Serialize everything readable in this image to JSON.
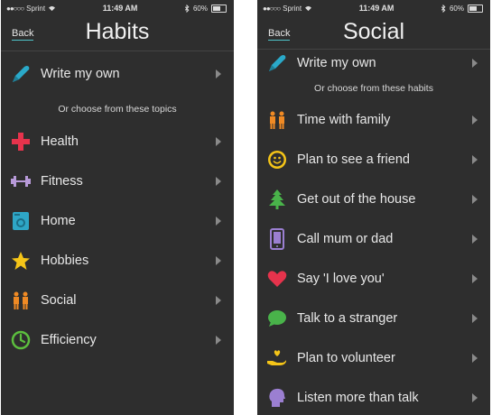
{
  "status_left": {
    "carrier": "Sprint",
    "time": "11:49 AM",
    "battery": "60%"
  },
  "status_right": {
    "carrier": "Sprint",
    "time": "11:49 AM",
    "battery": "60%"
  },
  "habits": {
    "back": "Back",
    "title": "Habits",
    "write_own": "Write my own",
    "subhead": "Or choose from these topics",
    "items": [
      {
        "label": "Health",
        "icon": "health-cross-icon"
      },
      {
        "label": "Fitness",
        "icon": "dumbbell-icon"
      },
      {
        "label": "Home",
        "icon": "washing-machine-icon"
      },
      {
        "label": "Hobbies",
        "icon": "star-icon"
      },
      {
        "label": "Social",
        "icon": "people-icon"
      },
      {
        "label": "Efficiency",
        "icon": "clock-icon"
      }
    ]
  },
  "social": {
    "back": "Back",
    "title": "Social",
    "write_own": "Write my own",
    "subhead": "Or choose from these habits",
    "items": [
      {
        "label": "Time with family",
        "icon": "family-icon"
      },
      {
        "label": "Plan to see a friend",
        "icon": "smiley-icon"
      },
      {
        "label": "Get out of the house",
        "icon": "tree-icon"
      },
      {
        "label": "Call mum or dad",
        "icon": "phone-icon"
      },
      {
        "label": "Say 'I love you'",
        "icon": "heart-icon"
      },
      {
        "label": "Talk to a stranger",
        "icon": "speech-bubble-icon"
      },
      {
        "label": "Plan to volunteer",
        "icon": "helping-hand-icon"
      },
      {
        "label": "Listen more than talk",
        "icon": "head-icon"
      }
    ]
  },
  "colors": {
    "background": "#2e2e2e",
    "accent": "#4fc3c8",
    "chevron": "#8a8a8a"
  }
}
